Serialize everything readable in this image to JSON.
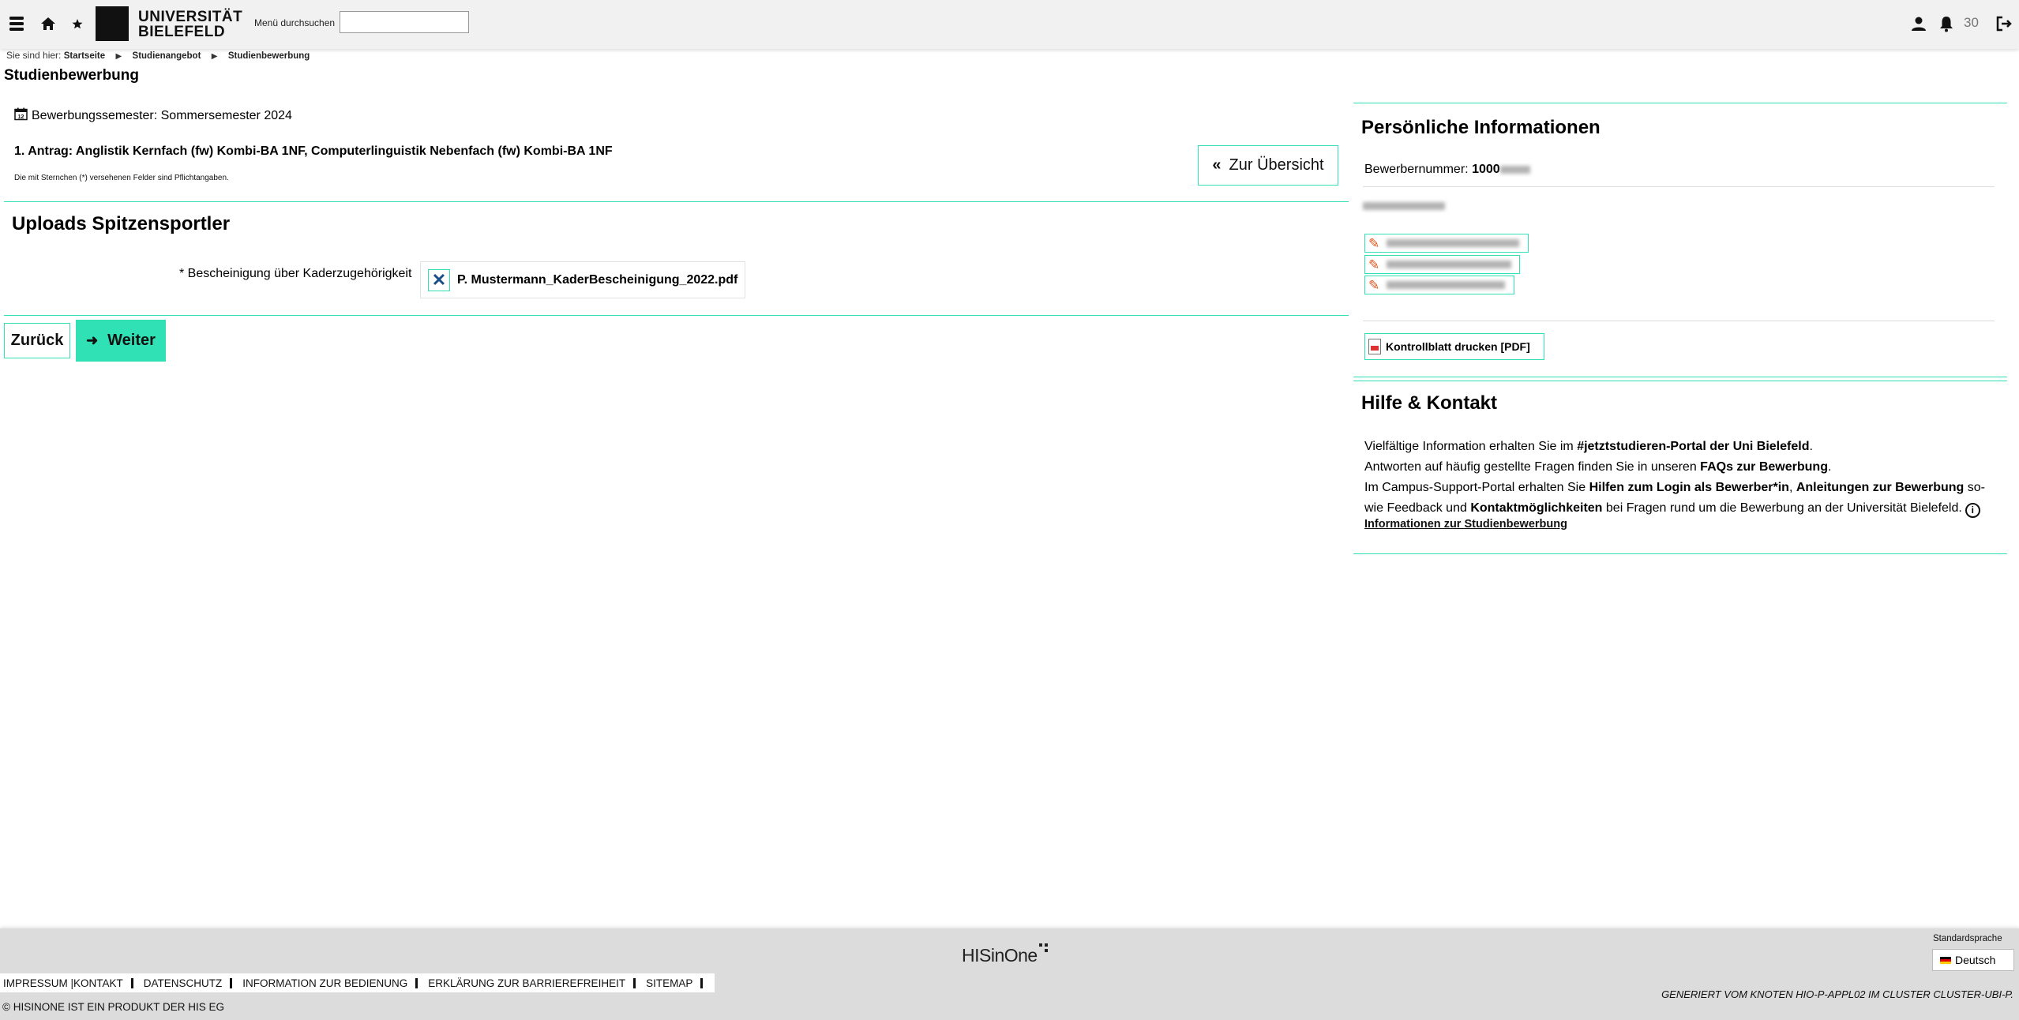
{
  "header": {
    "logo_line1": "UNIVERSITÄT",
    "logo_line2": "BIELEFELD",
    "menu_search_label": "Menü durchsuchen",
    "menu_search_value": "",
    "notification_count": "30"
  },
  "breadcrumb": {
    "prefix": "Sie sind hier:",
    "items": [
      "Startseite",
      "Studienangebot",
      "Studienbewerbung"
    ]
  },
  "page_title": "Studienbewerbung",
  "main": {
    "semester": "Bewerbungssemester: Sommersemester 2024",
    "antrag": "1. Antrag: Anglistik Kernfach (fw) Kombi-BA 1NF, Computerlinguistik Nebenfach (fw) Kombi-BA 1NF",
    "pflicht_hint": "Die mit Sternchen (*) versehenen Felder sind Pflichtangaben.",
    "overview_button": "Zur Übersicht",
    "section_title": "Uploads Spitzensportler",
    "field_label": "* Bescheinigung über Kaderzugehörigkeit",
    "file_name": "P. Mustermann_KaderBescheinigung_2022.pdf",
    "back_button": "Zurück",
    "next_button": "Weiter"
  },
  "personal": {
    "title": "Persönliche Informationen",
    "applicant_label": "Bewerbernummer:",
    "applicant_value": "1000",
    "print_button": "Kontrollblatt drucken [PDF]"
  },
  "help": {
    "title": "Hilfe & Kontakt",
    "line1_pre": "Vielfältige Information erhalten Sie im ",
    "line1_link": "#jetztstudieren-Portal der Uni Bielefeld",
    "line1_post": ".",
    "line2_pre": "Antworten auf häufig gestellte Fragen finden Sie in unseren ",
    "line2_link": "FAQs zur Bewerbung",
    "line2_post": ".",
    "line3_pre": "Im Campus-Support-Portal erhalten Sie ",
    "line3_link1": "Hilfen zum Login als Bewerber*in",
    "line3_mid1": ", ",
    "line3_link2": "Anleitungen zur Bewerbung",
    "line3_mid2": " so-wie Feedback und ",
    "line3_link3": "Kontaktmöglichkeiten",
    "line3_post": " bei Fragen rund um die Bewerbung an der Universität Bielefeld.",
    "info_link": "Informationen zur Studienbewerbung"
  },
  "footer": {
    "brand": "HISinOne",
    "links": [
      "Impressum |Kontakt",
      "Datenschutz",
      "Information zur Bedienung",
      "Erklärung zur Barrierefreiheit",
      "Sitemap"
    ],
    "copyright": "© HISINONE IST EIN PRODUKT DER HIS EG",
    "generated": "Generiert vom Knoten hio-p-appl02 im Cluster cluster-ubi-p.",
    "language_label": "Standardsprache",
    "language": "Deutsch"
  },
  "colors": {
    "accent": "#2fe1b4",
    "topbar_bg": "#f1f1f1",
    "footer_bg": "#dcdcdc",
    "edit_icon": "#e4531a"
  },
  "icons": [
    "menu-icon",
    "home-icon",
    "star-icon",
    "user-icon",
    "bell-icon",
    "logout-icon",
    "calendar-icon",
    "double-chevron-left-icon",
    "close-icon",
    "arrow-right-icon",
    "pencil-icon",
    "pdf-icon",
    "info-icon",
    "flag-de-icon"
  ]
}
